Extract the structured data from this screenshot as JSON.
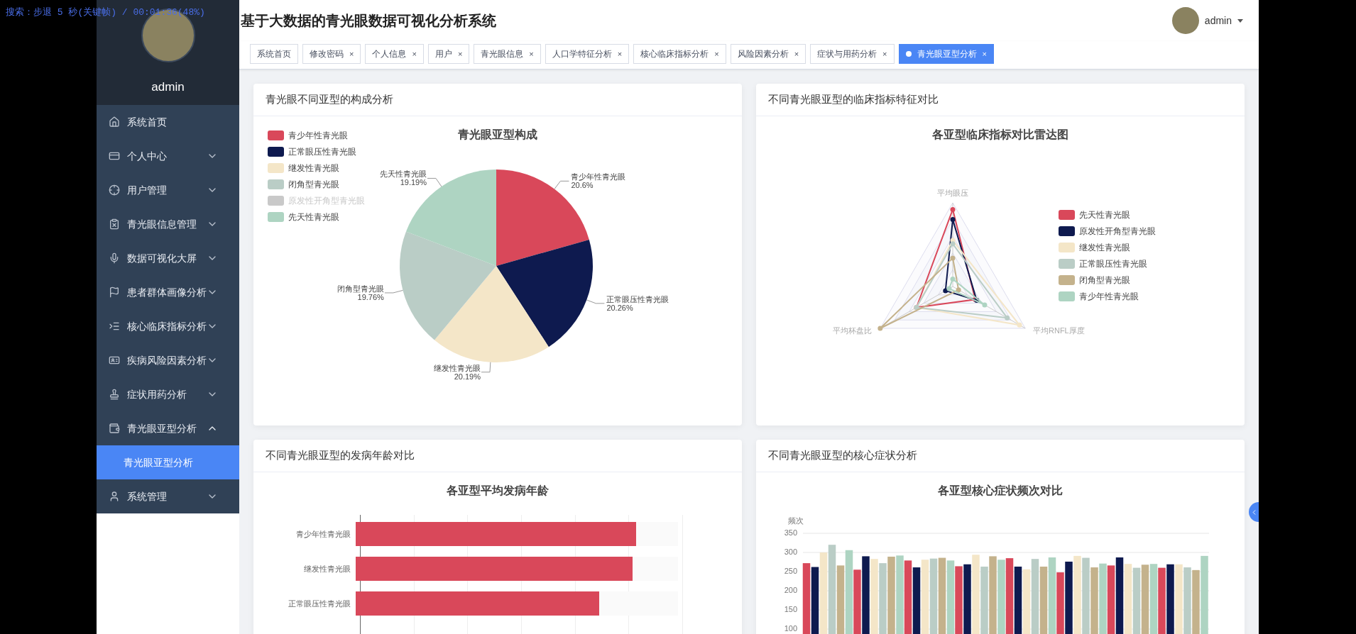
{
  "player_overlay": {
    "text": "搜索：步退 5 秒(关键帧) / 00:01:36(48%)"
  },
  "sidebar": {
    "user": "admin",
    "items": [
      {
        "label": "系统首页",
        "kind": "link",
        "selected": false
      },
      {
        "label": "个人中心",
        "kind": "submenu",
        "expanded": false,
        "selected": false
      },
      {
        "label": "用户管理",
        "kind": "submenu",
        "expanded": false,
        "selected": false
      },
      {
        "label": "青光眼信息管理",
        "kind": "submenu",
        "expanded": false,
        "selected": false
      },
      {
        "label": "数据可视化大屏",
        "kind": "submenu",
        "expanded": false,
        "selected": false
      },
      {
        "label": "患者群体画像分析",
        "kind": "submenu",
        "expanded": false,
        "selected": false
      },
      {
        "label": "核心临床指标分析",
        "kind": "submenu",
        "expanded": false,
        "selected": false
      },
      {
        "label": "疾病风险因素分析",
        "kind": "submenu",
        "expanded": false,
        "selected": false
      },
      {
        "label": "症状用药分析",
        "kind": "submenu",
        "expanded": false,
        "selected": false
      },
      {
        "label": "青光眼亚型分析",
        "kind": "submenu",
        "expanded": true,
        "selected": false,
        "children": [
          {
            "label": "青光眼亚型分析",
            "selected": true
          }
        ]
      },
      {
        "label": "系统管理",
        "kind": "submenu",
        "expanded": false,
        "selected": false
      }
    ]
  },
  "header": {
    "title": "基于大数据的青光眼数据可视化分析系统",
    "user": "admin"
  },
  "tabs": [
    {
      "label": "系统首页",
      "selected": false,
      "closable": false
    },
    {
      "label": "修改密码",
      "selected": false,
      "closable": true
    },
    {
      "label": "个人信息",
      "selected": false,
      "closable": true
    },
    {
      "label": "用户",
      "selected": false,
      "closable": true
    },
    {
      "label": "青光眼信息",
      "selected": false,
      "closable": true
    },
    {
      "label": "人口学特征分析",
      "selected": false,
      "closable": true
    },
    {
      "label": "核心临床指标分析",
      "selected": false,
      "closable": true
    },
    {
      "label": "风险因素分析",
      "selected": false,
      "closable": true
    },
    {
      "label": "症状与用药分析",
      "selected": false,
      "closable": true
    },
    {
      "label": "青光眼亚型分析",
      "selected": true,
      "closable": true
    }
  ],
  "close_mark": "×",
  "composition_card": {
    "title": "青光眼不同亚型的构成分析",
    "legend": [
      {
        "label": "青少年性青光眼",
        "color": "#d9485a",
        "hidden": false
      },
      {
        "label": "正常眼压性青光眼",
        "color": "#0e1a4f",
        "hidden": false
      },
      {
        "label": "继发性青光眼",
        "color": "#f4e6c8",
        "hidden": false
      },
      {
        "label": "闭角型青光眼",
        "color": "#bacdc6",
        "hidden": false
      },
      {
        "label": "原发性开角型青光眼",
        "color": "#c9c9c9",
        "hidden": true
      },
      {
        "label": "先天性青光眼",
        "color": "#aed4c2",
        "hidden": false
      }
    ],
    "chart_data": {
      "type": "pie",
      "title": "青光眼亚型构成",
      "categories": [
        "青少年性青光眼",
        "正常眼压性青光眼",
        "继发性青光眼",
        "闭角型青光眼",
        "先天性青光眼"
      ],
      "values": [
        20.6,
        20.26,
        20.19,
        19.76,
        19.19
      ],
      "value_labels": [
        "20.6%",
        "20.26%",
        "20.19%",
        "19.76%",
        "19.19%"
      ]
    }
  },
  "radar_card": {
    "title": "不同青光眼亚型的临床指标特征对比",
    "chart_title": "各亚型临床指标对比雷达图",
    "axes": [
      "平均眼压",
      "平均杯盘比",
      "平均RNFL厚度"
    ],
    "legend": [
      {
        "label": "先天性青光眼",
        "color": "#d9485a"
      },
      {
        "label": "原发性开角型青光眼",
        "color": "#0e1a4f"
      },
      {
        "label": "继发性青光眼",
        "color": "#f4e6c8"
      },
      {
        "label": "正常眼压性青光眼",
        "color": "#bacdc6"
      },
      {
        "label": "闭角型青光眼",
        "color": "#c4b28c"
      },
      {
        "label": "青少年性青光眼",
        "color": "#aed4c2"
      }
    ]
  },
  "age_card": {
    "title": "不同青光眼亚型的发病年龄对比",
    "chart_title": "各亚型平均发病年龄",
    "bars": [
      {
        "label": "青少年性青光眼",
        "level": 0.87
      },
      {
        "label": "继发性青光眼",
        "level": 0.86
      },
      {
        "label": "正常眼压性青光眼",
        "level": 0.755
      }
    ]
  },
  "symptom_card": {
    "title": "不同青光眼亚型的核心症状分析",
    "chart_data": {
      "type": "bar",
      "title": "各亚型核心症状频次对比",
      "ylabel": "频次",
      "grid": true,
      "ylim": [
        0,
        350
      ],
      "yticks": [
        100,
        150,
        200,
        250,
        300,
        350
      ],
      "series": [
        {
          "color": "#d9485a",
          "values": [
            272,
            255,
            279,
            264,
            285,
            248,
            266,
            260
          ]
        },
        {
          "color": "#0e1a4f",
          "values": [
            262,
            290,
            261,
            269,
            263,
            276,
            287,
            269
          ]
        },
        {
          "color": "#f4e6c8",
          "values": [
            300,
            283,
            281,
            294,
            256,
            291,
            270,
            269
          ]
        },
        {
          "color": "#bacdc6",
          "values": [
            320,
            272,
            284,
            263,
            283,
            286,
            260,
            261
          ]
        },
        {
          "color": "#c4b28c",
          "values": [
            266,
            289,
            286,
            290,
            263,
            261,
            268,
            254
          ]
        },
        {
          "color": "#aed4c2",
          "values": [
            306,
            292,
            279,
            281,
            287,
            271,
            270,
            291
          ]
        }
      ]
    }
  }
}
